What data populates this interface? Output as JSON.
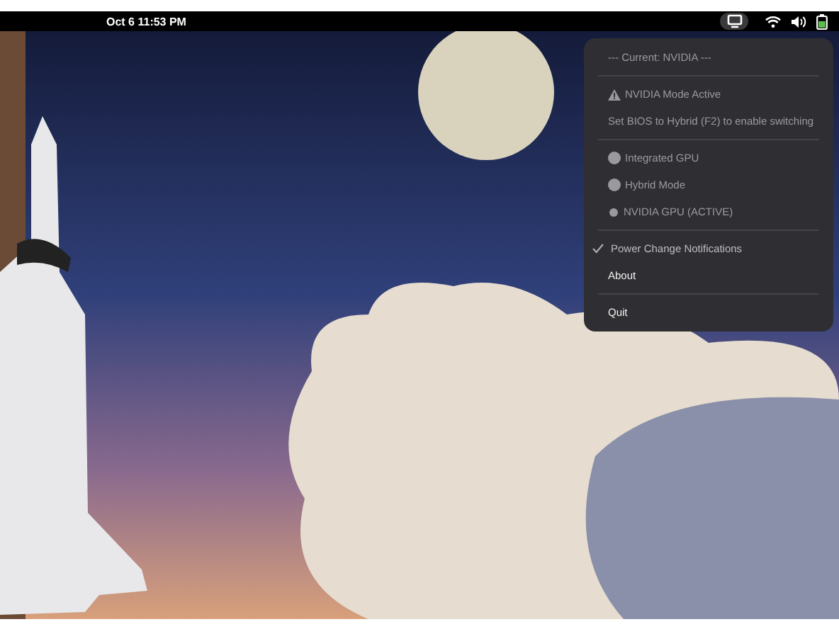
{
  "top_bar": {
    "clock": "Oct 6  11:53 PM",
    "tray_active": true
  },
  "menu": {
    "items": [
      {
        "kind": "header",
        "label": "--- Current: NVIDIA ---",
        "disabled": true
      },
      {
        "kind": "separator"
      },
      {
        "kind": "warning",
        "label": "NVIDIA Mode Active",
        "disabled": true
      },
      {
        "kind": "label",
        "label": "Set BIOS to Hybrid (F2) to enable switching",
        "disabled": true
      },
      {
        "kind": "separator"
      },
      {
        "kind": "radio",
        "label": "Integrated GPU",
        "disabled": true,
        "selected": false
      },
      {
        "kind": "radio",
        "label": "Hybrid Mode",
        "disabled": true,
        "selected": false
      },
      {
        "kind": "radio",
        "label": "NVIDIA GPU (ACTIVE)",
        "disabled": true,
        "selected": true
      },
      {
        "kind": "separator"
      },
      {
        "kind": "check",
        "label": "Power Change Notifications",
        "disabled": false,
        "checked": true
      },
      {
        "kind": "action",
        "label": "About",
        "disabled": false
      },
      {
        "kind": "separator"
      },
      {
        "kind": "action",
        "label": "Quit",
        "disabled": false
      }
    ]
  }
}
